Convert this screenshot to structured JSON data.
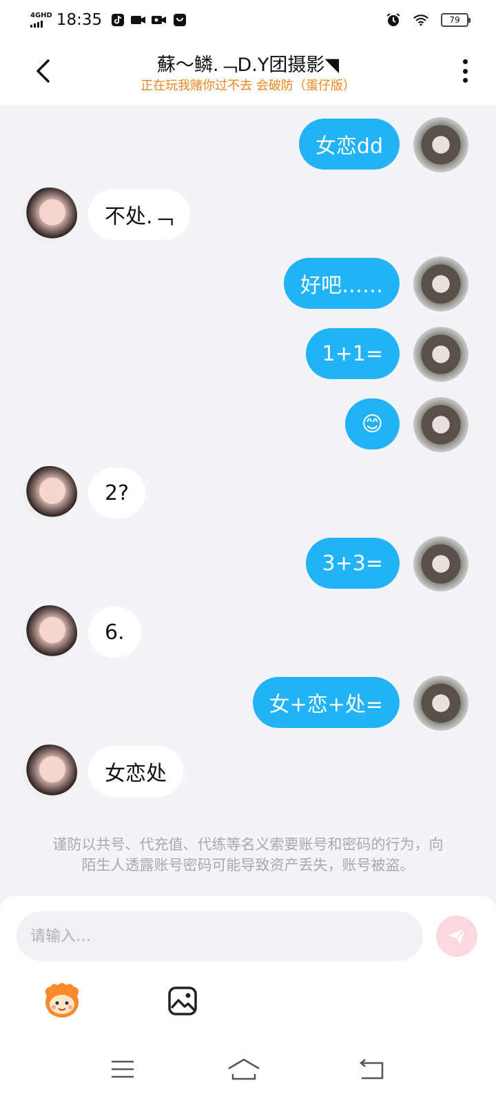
{
  "status_bar": {
    "network": "4GHD",
    "time": "18:35",
    "battery": "79",
    "icons": [
      "tiktok-icon",
      "video-icon",
      "video-call-icon",
      "shopping-bag-icon",
      "alarm-icon",
      "wifi-icon",
      "battery-icon"
    ]
  },
  "header": {
    "title": "蘇～鳞.﹁D.Y团摄影◥",
    "subtitle": "正在玩我赌你过不去  会破防（蛋仔版）",
    "subtitle_color": "#f0851c"
  },
  "messages": [
    {
      "from": "me",
      "text": "女恋dd"
    },
    {
      "from": "them",
      "text": "不处.﹁"
    },
    {
      "from": "me",
      "text": "好吧……"
    },
    {
      "from": "me",
      "text": "1+1="
    },
    {
      "from": "me",
      "text": "😊"
    },
    {
      "from": "them",
      "text": "2?"
    },
    {
      "from": "me",
      "text": "3+3="
    },
    {
      "from": "them",
      "text": "6."
    },
    {
      "from": "me",
      "text": "女+恋+处="
    },
    {
      "from": "them",
      "text": "女恋处"
    }
  ],
  "notice": "谨防以共号、代充值、代练等名义索要账号和密码的行为，向陌生人透露账号密码可能导致资产丢失，账号被盗。",
  "composer": {
    "placeholder": "请输入…"
  },
  "colors": {
    "my_bubble": "#22b3f6",
    "their_bubble": "#ffffff",
    "background": "#f4f4f8",
    "send_button": "#fcd9dc"
  }
}
